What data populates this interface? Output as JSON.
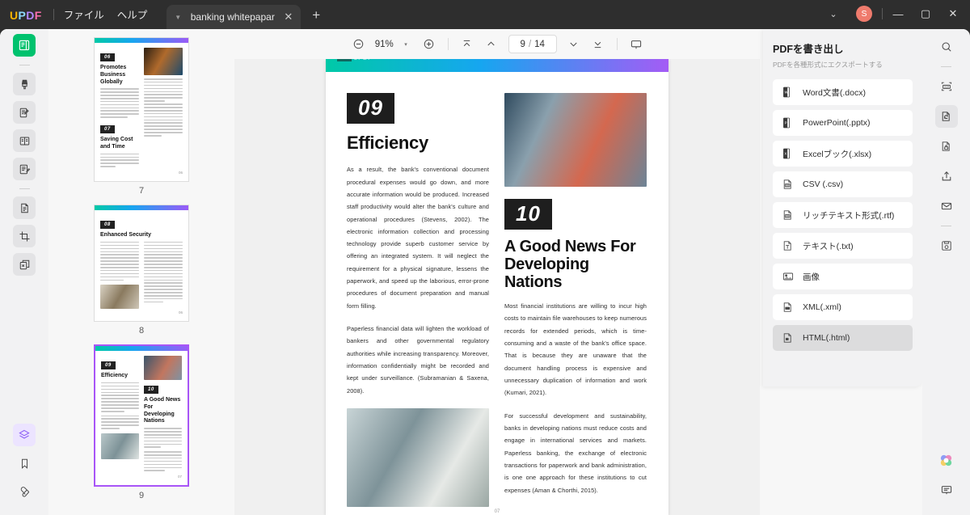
{
  "titlebar": {
    "logo": "UPDF",
    "menus": [
      "ファイル",
      "ヘルプ"
    ],
    "tab_title": "banking whitepapar",
    "tab_close": "✕",
    "new_tab": "+",
    "chevron": "⌄",
    "avatar_initial": "S",
    "minimize": "—",
    "maximize": "▢",
    "close": "✕"
  },
  "left_rail": {
    "items": [
      {
        "name": "reader-tool",
        "icon": "book-reader-icon"
      },
      {
        "name": "markup-tool",
        "icon": "highlighter-icon"
      },
      {
        "name": "edit-pdf-tool",
        "icon": "edit-document-icon"
      },
      {
        "name": "form-tool",
        "icon": "form-fields-icon"
      },
      {
        "name": "comment-tool",
        "icon": "comment-pen-icon"
      },
      {
        "name": "page-tool",
        "icon": "page-icon"
      },
      {
        "name": "crop-tool",
        "icon": "crop-icon"
      },
      {
        "name": "organize-tool",
        "icon": "organize-pages-icon"
      }
    ],
    "bottom": [
      {
        "name": "layers-panel",
        "icon": "layers-icon"
      },
      {
        "name": "bookmark-panel",
        "icon": "bookmark-icon"
      },
      {
        "name": "attachment-panel",
        "icon": "paperclip-icon"
      }
    ]
  },
  "toolbar": {
    "zoom_out": "zoom-out-icon",
    "zoom_value": "91%",
    "zoom_caret": "▾",
    "zoom_in": "zoom-in-icon",
    "first_page": "first-page-icon",
    "prev_page": "previous-page-icon",
    "current_page": "9",
    "separator": "/",
    "total_pages": "14",
    "next_page": "next-page-icon",
    "last_page": "last-page-icon",
    "presentation": "presentation-mode-icon"
  },
  "thumbnails": [
    {
      "page_number": "7",
      "selected": false,
      "sections": [
        {
          "number": "06",
          "title": "Promotes\nBusiness Globally"
        },
        {
          "number": "07",
          "title": "Saving\nCost and Time"
        }
      ],
      "footer": "06"
    },
    {
      "page_number": "8",
      "selected": false,
      "sections": [
        {
          "number": "08",
          "title": "Enhanced Security"
        }
      ],
      "footer": "06"
    },
    {
      "page_number": "9",
      "selected": true,
      "sections": [
        {
          "number": "09",
          "title": "Efficiency"
        },
        {
          "number": "10",
          "title": "A Good News For\nDeveloping Nations"
        }
      ],
      "footer": "07"
    }
  ],
  "document": {
    "brand": "UPDF",
    "left_column": {
      "number": "09",
      "title": "Efficiency",
      "paragraphs": [
        "As a result, the bank's conventional document procedural expenses would go down, and more accurate information would be produced. Increased staff productivity would alter the bank's culture and operational procedures (Stevens, 2002). The electronic information collection and processing technology provide superb customer service by offering an integrated system. It will neglect the requirement for a physical signature, lessens the paperwork, and speed up the laborious, error-prone procedures of document preparation and manual form filling.",
        "Paperless financial data will lighten the workload of bankers and other governmental regulatory authorities while increasing transparency. Moreover, information confidentially might be recorded and kept under surveillance. (Subramanian & Saxena, 2008)."
      ]
    },
    "right_column": {
      "number": "10",
      "title": "A Good News For Developing Nations",
      "paragraphs": [
        "Most financial institutions are willing to incur high costs to maintain file warehouses to keep numerous records for extended periods, which is time-consuming and a waste of the bank's office space. That is because they are unaware that the document handling process is expensive and unnecessary duplication of information and work (Kumari, 2021).",
        "For successful development and sustainability, banks in developing nations must reduce costs and engage in international services and markets. Paperless banking, the exchange of electronic transactions for paperwork and bank administration, is one one approach for these institutions to cut expenses (Aman & Chorthi, 2015)."
      ]
    },
    "page_footer": "07"
  },
  "export_panel": {
    "title": "PDFを書き出し",
    "subtitle": "PDFを各種形式にエクスポートする",
    "items": [
      {
        "label": "Word文書(.docx)",
        "icon": "word-icon",
        "selected": false
      },
      {
        "label": "PowerPoint(.pptx)",
        "icon": "powerpoint-icon",
        "selected": false
      },
      {
        "label": "Excelブック(.xlsx)",
        "icon": "excel-icon",
        "selected": false
      },
      {
        "label": "CSV (.csv)",
        "icon": "csv-icon",
        "selected": false
      },
      {
        "label": "リッチテキスト形式(.rtf)",
        "icon": "rtf-icon",
        "selected": false
      },
      {
        "label": "テキスト(.txt)",
        "icon": "txt-icon",
        "selected": false
      },
      {
        "label": "画像",
        "icon": "image-icon",
        "selected": false
      },
      {
        "label": "XML(.xml)",
        "icon": "xml-icon",
        "selected": false
      },
      {
        "label": "HTML(.html)",
        "icon": "html-icon",
        "selected": true
      }
    ]
  },
  "right_rail": {
    "items": [
      {
        "name": "search-panel",
        "icon": "search-icon"
      },
      {
        "name": "ocr-tool",
        "icon": "ocr-icon"
      },
      {
        "name": "convert-tool",
        "icon": "convert-icon"
      },
      {
        "name": "protect-tool",
        "icon": "lock-document-icon"
      },
      {
        "name": "share-tool",
        "icon": "share-upload-icon"
      },
      {
        "name": "email-tool",
        "icon": "envelope-icon"
      },
      {
        "name": "save-tool",
        "icon": "save-disk-icon"
      }
    ],
    "bottom": [
      {
        "name": "ai-assistant",
        "icon": "ai-sparkle-icon"
      },
      {
        "name": "feedback",
        "icon": "chat-bubble-icon"
      }
    ]
  },
  "colors": {
    "accent_green": "#00c26e",
    "accent_purple": "#a855f7",
    "avatar": "#ef7b6d",
    "panel_bg": "#f2f2f3",
    "titlebar_bg": "#2e2e2e"
  }
}
